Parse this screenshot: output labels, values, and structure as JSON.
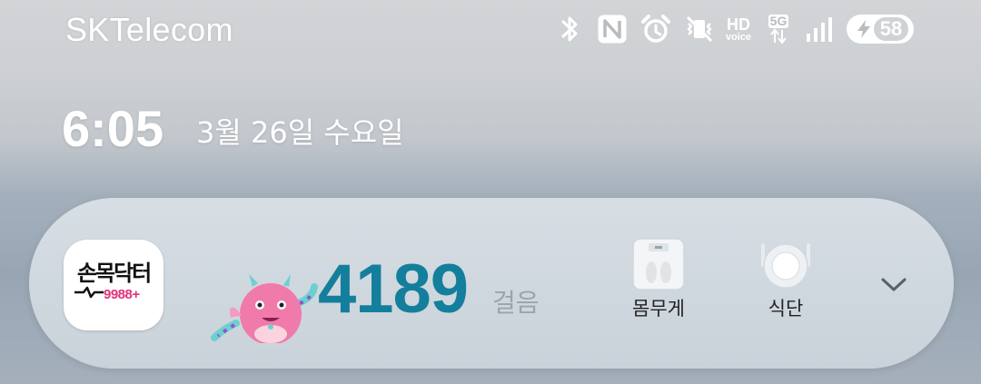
{
  "status_bar": {
    "carrier": "SKTelecom",
    "icons": [
      "bluetooth-icon",
      "nfc-icon",
      "alarm-icon",
      "vibrate-icon",
      "hd-voice-icon",
      "5g-icon",
      "signal-icon"
    ],
    "hd_top": "HD",
    "hd_sub": "voice",
    "network": "5G",
    "battery_level": "58"
  },
  "lockscreen": {
    "time": "6:05",
    "date": "3월 26일 수요일"
  },
  "widget": {
    "app_logo_text": "손목닥터",
    "app_logo_sub": "9988+",
    "steps_value": "4189",
    "steps_unit": "걸음",
    "actions": [
      {
        "label": "몸무게",
        "icon": "scale-icon"
      },
      {
        "label": "식단",
        "icon": "meal-plate-icon"
      }
    ],
    "expand_icon": "chevron-down-icon",
    "colors": {
      "steps": "#147f9c",
      "logo_accent": "#e2337a",
      "mascot": "#f07aa9"
    }
  }
}
